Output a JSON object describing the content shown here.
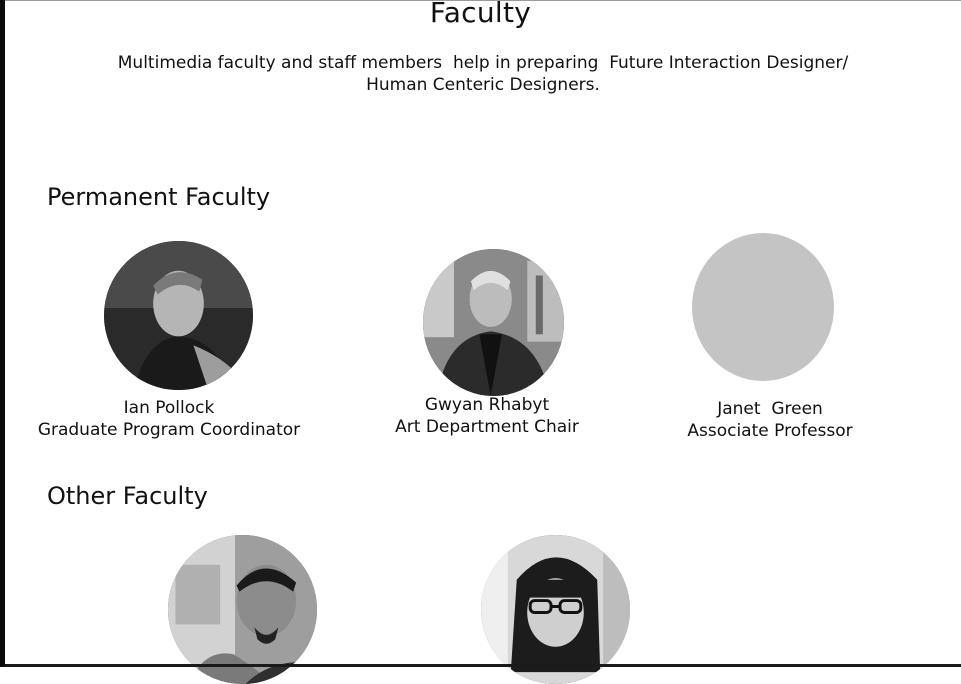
{
  "page": {
    "title": "Faculty",
    "intro": "Multimedia faculty and staff members  help in preparing  Future Interaction Designer/\nHuman Centeric Designers."
  },
  "sections": {
    "permanent": {
      "title": "Permanent Faculty",
      "members": [
        {
          "name": "Ian Pollock",
          "role": "Graduate Program Coordinator"
        },
        {
          "name": "Gwyan Rhabyt",
          "role": "Art Department Chair"
        },
        {
          "name": "Janet  Green",
          "role": "Associate Professor"
        }
      ]
    },
    "other": {
      "title": "Other Faculty"
    }
  },
  "colors": {
    "background": "#ffffff",
    "text": "#111111",
    "placeholder_photo": "#c4c4c4"
  }
}
